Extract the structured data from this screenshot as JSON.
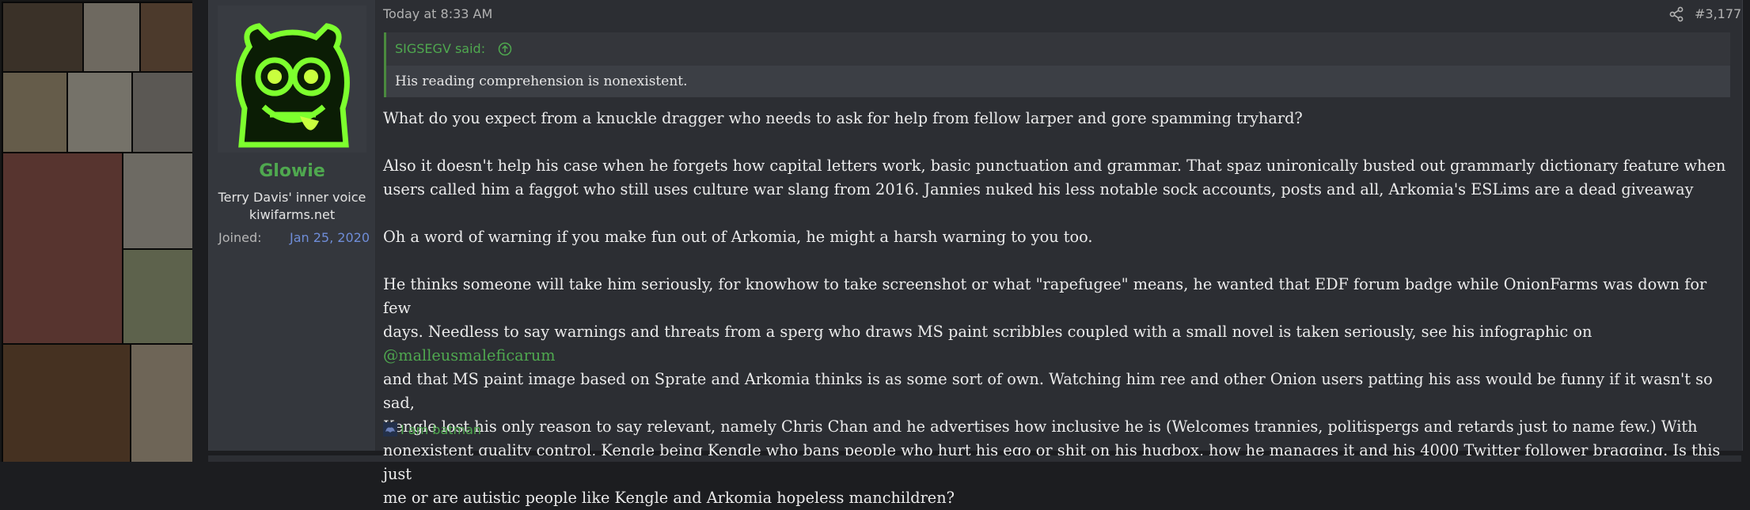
{
  "post": {
    "timestamp": "Today at 8:33 AM",
    "post_number": "#3,177",
    "share_icon": "share-icon"
  },
  "user": {
    "name": "Glowie",
    "title": "Terry Davis' inner voice",
    "site": "kiwifarms.net",
    "joined_label": "Joined:",
    "joined_date": "Jan 25, 2020",
    "avatar_icon": "glowing-green-mascot-avatar"
  },
  "quote": {
    "author": "SIGSEGV said:",
    "text": "His reading comprehension is nonexistent."
  },
  "body": {
    "p1": "What do you expect from a knuckle dragger who needs to ask for help from fellow larper and gore spamming tryhard?",
    "p2_l1": "Also it doesn't help his case when he forgets how capital letters work, basic punctuation and grammar. That spaz unironically busted out grammarly dictionary feature when",
    "p2_l2": "users called him a faggot who still uses culture war slang from 2016. Jannies nuked his less notable sock accounts, posts and all, Arkomia's ESLims are a dead giveaway",
    "p3": "Oh a word of warning if you make fun out of Arkomia, he might a harsh warning to you too.",
    "p4_l1": "He thinks someone will take him seriously, for knowhow to take screenshot or what \"rapefugee\" means, he wanted that EDF forum badge while OnionFarms was down for few",
    "p4_l2": "days. Needless to say warnings and threats from a sperg who draws MS paint scribbles coupled with a small novel is taken seriously, see his infographic on",
    "p4_mention": "@malleusmaleficarum",
    "p4_l3": "and that MS paint image based on Sprate and Arkomia thinks is as some sort of own. Watching him ree and other Onion users patting his ass would be funny if it wasn't so sad,",
    "p4_l4": "Kengle lost his only reason to say relevant, namely Chris Chan and he advertises how inclusive he is (Welcomes trannies, politispergs and retards just to name few.) With",
    "p4_l5": "nonexistent quality control, Kengle being Kengle who bans people who hurt his ego or shit on his hugbox, how he manages it and his 4000 Twitter follower bragging. Is this just",
    "p4_l6": "me or are autistic people like Kengle and Arkomia hopeless manchildren?"
  },
  "signature": {
    "text": "I am batman"
  },
  "colors": {
    "accent_green": "#4fa84f",
    "date_blue": "#6f8dd8",
    "post_bg": "#2c2e33",
    "user_col_bg": "#34373d"
  }
}
